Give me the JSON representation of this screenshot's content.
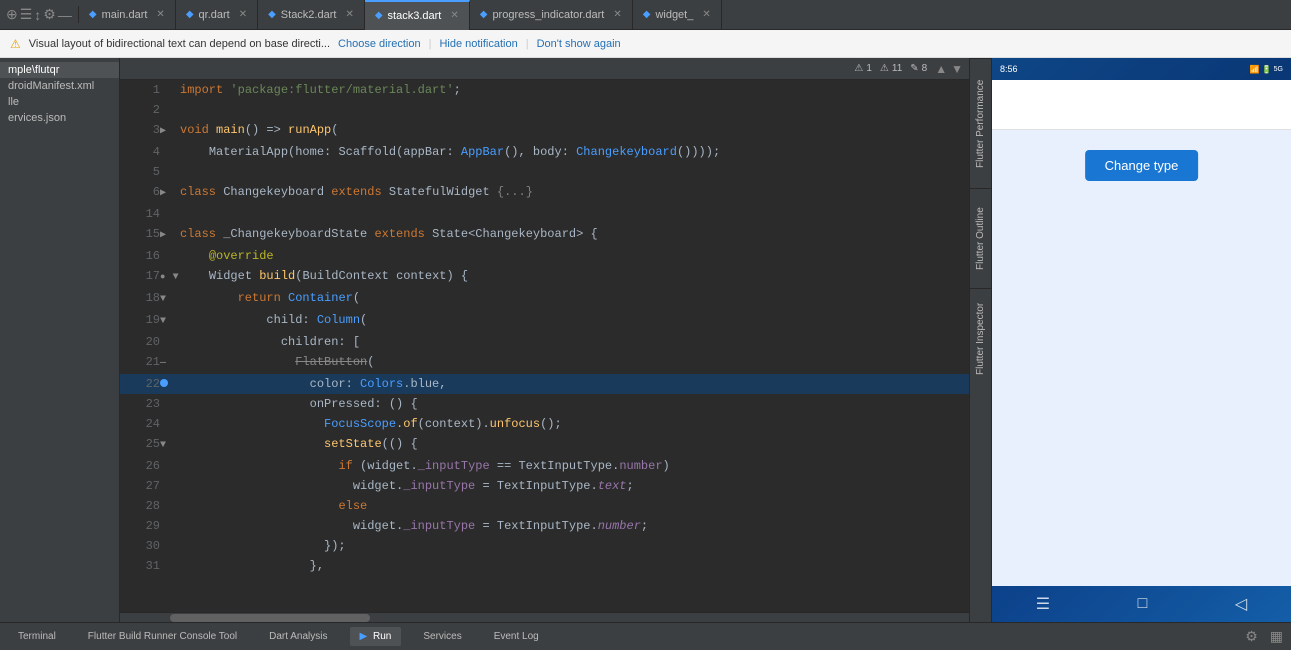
{
  "tabs": [
    {
      "label": "main.dart",
      "active": false,
      "icon": "dart"
    },
    {
      "label": "qr.dart",
      "active": false,
      "icon": "dart"
    },
    {
      "label": "Stack2.dart",
      "active": false,
      "icon": "dart"
    },
    {
      "label": "stack3.dart",
      "active": true,
      "icon": "dart"
    },
    {
      "label": "progress_indicator.dart",
      "active": false,
      "icon": "dart"
    },
    {
      "label": "widget_",
      "active": false,
      "icon": "dart"
    }
  ],
  "notification": {
    "text": "Visual layout of bidirectional text can depend on base directi...",
    "choose_direction": "Choose direction",
    "hide": "Hide notification",
    "dont_show": "Don't show again"
  },
  "editor": {
    "toolbar": {
      "warnings": "1",
      "errors": "11",
      "info": "8"
    },
    "lines": [
      {
        "num": 1,
        "code": "import 'package:flutter/material.dart';"
      },
      {
        "num": 2,
        "code": ""
      },
      {
        "num": 3,
        "code": "void main() => runApp("
      },
      {
        "num": 4,
        "code": "    MaterialApp(home: Scaffold(appBar: AppBar(), body: Changekeyboard())));"
      },
      {
        "num": 5,
        "code": ""
      },
      {
        "num": 6,
        "code": "class Changekeyboard extends StatefulWidget {...}"
      },
      {
        "num": 14,
        "code": ""
      },
      {
        "num": 15,
        "code": "class _ChangekeyboardState extends State<Changekeyboard> {"
      },
      {
        "num": 16,
        "code": "    @override"
      },
      {
        "num": 17,
        "code": "    Widget build(BuildContext context) {"
      },
      {
        "num": 18,
        "code": "        return Container("
      },
      {
        "num": 19,
        "code": "            child: Column("
      },
      {
        "num": 20,
        "code": "              children: ["
      },
      {
        "num": 21,
        "code": "                FlatButton("
      },
      {
        "num": 22,
        "code": "                  color: Colors.blue,"
      },
      {
        "num": 23,
        "code": "                  onPressed: () {"
      },
      {
        "num": 24,
        "code": "                    FocusScope.of(context).unfocus();"
      },
      {
        "num": 25,
        "code": "                    setState(() {"
      },
      {
        "num": 26,
        "code": "                      if (widget._inputType == TextInputType.number)"
      },
      {
        "num": 27,
        "code": "                        widget._inputType = TextInputType.text;"
      },
      {
        "num": 28,
        "code": "                      else"
      },
      {
        "num": 29,
        "code": "                        widget._inputType = TextInputType.number;"
      },
      {
        "num": 30,
        "code": "                    });"
      },
      {
        "num": 31,
        "code": "                  },"
      }
    ]
  },
  "sidebar": {
    "items": [
      "mple\\flutqr",
      "droidManifest.xml",
      "lle",
      "ervices.json"
    ]
  },
  "flutter_panels": {
    "performance": "Flutter Performance",
    "outline": "Flutter Outline",
    "inspector": "Flutter Inspector"
  },
  "device": {
    "time": "8:56",
    "change_type_btn": "Change type",
    "screen_bg": "#e8f0fe"
  },
  "status_tabs": [
    {
      "label": "Terminal",
      "active": false
    },
    {
      "label": "Flutter Build Runner Console Tool",
      "active": false
    },
    {
      "label": "Dart Analysis",
      "active": false
    },
    {
      "label": "Run",
      "active": true
    },
    {
      "label": "Services",
      "active": false
    },
    {
      "label": "Event Log",
      "active": false
    }
  ]
}
